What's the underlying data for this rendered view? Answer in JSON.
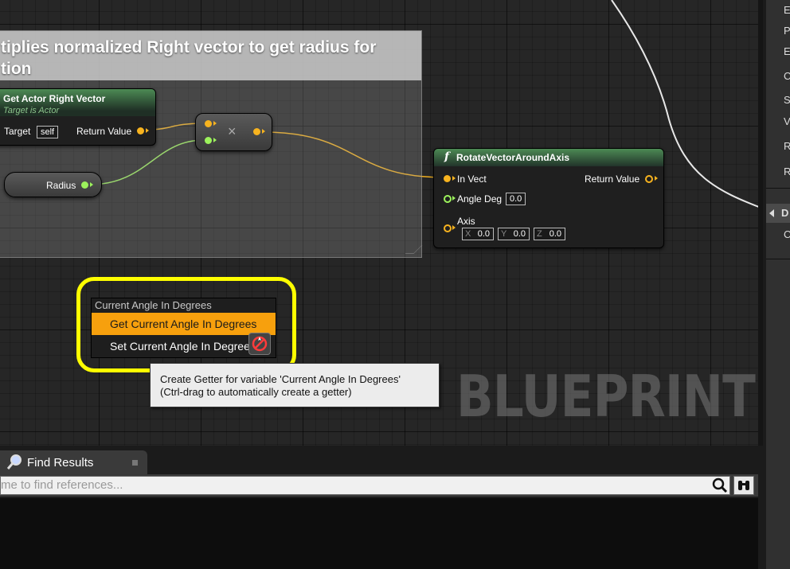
{
  "comment": {
    "text_line1": "tiplies normalized Right vector to get radius for",
    "text_line2": "tion"
  },
  "node_right_vector": {
    "title": "Get Actor Right Vector",
    "subtitle": "Target is Actor",
    "target_label": "Target",
    "target_value": "self",
    "return_label": "Return Value"
  },
  "node_multiply": {
    "symbol": "×"
  },
  "node_radius": {
    "label": "Radius"
  },
  "node_rotate": {
    "title": "RotateVectorAroundAxis",
    "func_glyph": "f",
    "in_vect_label": "In Vect",
    "return_label": "Return Value",
    "angle_label": "Angle Deg",
    "angle_value": "0.0",
    "axis_label": "Axis",
    "axis_x_label": "X",
    "axis_x": "0.0",
    "axis_y_label": "Y",
    "axis_y": "0.0",
    "axis_z_label": "Z",
    "axis_z": "0.0"
  },
  "menu": {
    "header": "Current Angle In Degrees",
    "items": [
      {
        "label": "Get Current Angle In Degrees",
        "selected": true
      },
      {
        "label": "Set Current Angle In Degrees",
        "selected": false
      }
    ]
  },
  "tooltip": {
    "line1": "Create Getter for variable 'Current Angle In Degrees'",
    "line2": "(Ctrl-drag to automatically create a getter)"
  },
  "watermark": "BLUEPRINT",
  "right_panel": {
    "items": [
      "E",
      "P",
      "E",
      "C",
      "S",
      "V",
      "R",
      "R"
    ],
    "section": "D",
    "section_item": "C"
  },
  "find_results": {
    "tab_label": "Find Results",
    "search_placeholder": "me to find references..."
  },
  "colors": {
    "vector_pin": "#f7b31f",
    "float_pin": "#9cf25c",
    "highlight": "#ffff00",
    "menu_selected": "#f7a00d"
  },
  "icons": [
    "magnifier-icon",
    "search-icon",
    "binoculars-icon",
    "function-icon",
    "no-drop-cursor-icon"
  ]
}
